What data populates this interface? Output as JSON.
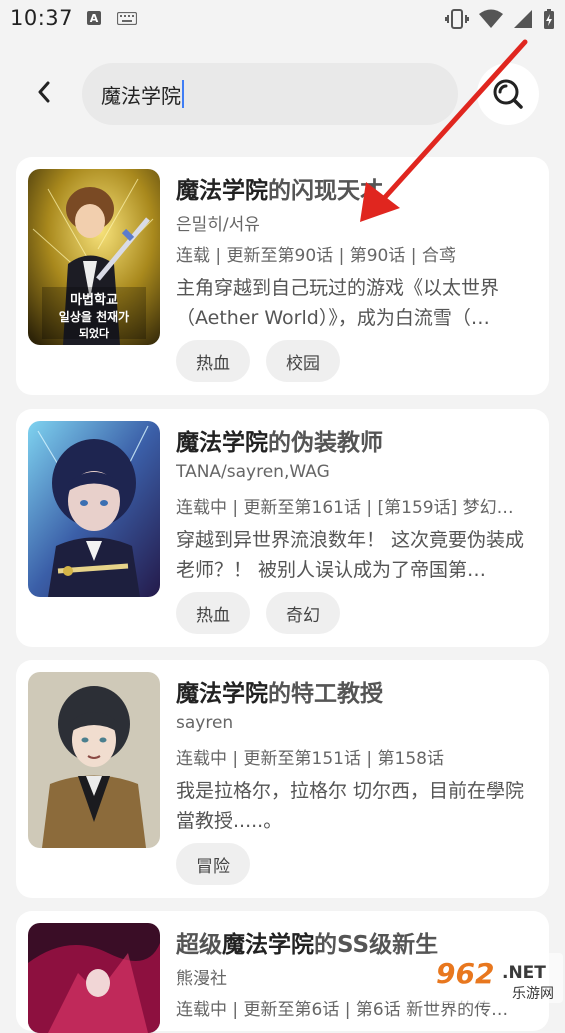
{
  "status_bar": {
    "time": "10:37",
    "a_badge": "A"
  },
  "search": {
    "query": "魔法学院"
  },
  "results": [
    {
      "title_highlight": "魔法学院",
      "title_rest": "的闪现天才",
      "authors": "은밀히/서유",
      "info": "连载 | 更新至第90话 | 第90话 | 合鸢",
      "desc": "主角穿越到自己玩过的游戏《以太世界（Aether World）》，成为白流雪（…",
      "tags": [
        "热血",
        "校园"
      ],
      "cover_text": "마법학교 일상을 천재가 되었다"
    },
    {
      "title_highlight": "魔法学院",
      "title_rest": "的伪装教师",
      "authors": "TANA/sayren,WAG",
      "info": "连载中 | 更新至第161话 | [第159话] 梦幻…",
      "desc": "穿越到异世界流浪数年！ 这次竟要伪装成老师？！ 被别人误认成为了帝国第…",
      "tags": [
        "热血",
        "奇幻"
      ]
    },
    {
      "title_highlight": "魔法学院",
      "title_rest": "的特工教授",
      "authors": "sayren",
      "info": "连载中 | 更新至第151话 | 第158话",
      "desc": "我是拉格尔，拉格尔 切尔西，目前在學院當教授.....。",
      "tags": [
        "冒险"
      ]
    },
    {
      "title_prefix": "超级",
      "title_highlight": "魔法学院",
      "title_rest": "的SS级新生",
      "authors": "熊漫社",
      "info": "连载中 | 更新至第6话 | 第6话 新世界的传…"
    }
  ],
  "watermark": {
    "number": "962",
    "suffix": ".NET",
    "sub": "乐游网"
  },
  "colors": {
    "accent_caret": "#3f7df5",
    "arrow": "#e0261f",
    "background": "#f3f3f3"
  }
}
